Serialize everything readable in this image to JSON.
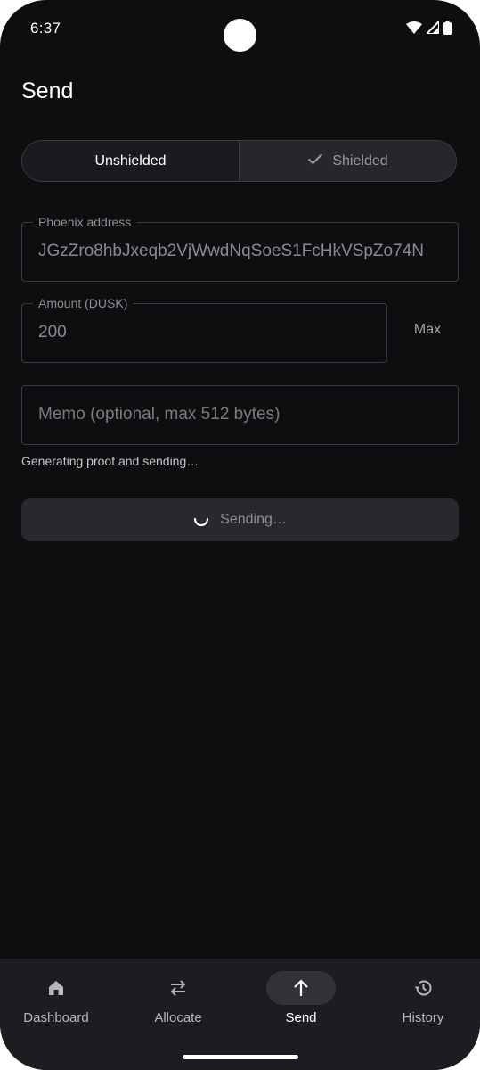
{
  "status_bar": {
    "time": "6:37"
  },
  "page": {
    "title": "Send"
  },
  "toggle": {
    "unshielded_label": "Unshielded",
    "shielded_label": "Shielded",
    "selected": "Unshielded"
  },
  "address_field": {
    "label": "Phoenix address",
    "value": "JGzZro8hbJxeqb2VjWwdNqSoeS1FcHkVSpZo74N"
  },
  "amount_field": {
    "label": "Amount (DUSK)",
    "value": "200",
    "max_label": "Max"
  },
  "memo_field": {
    "placeholder": "Memo (optional, max 512 bytes)"
  },
  "status": {
    "message": "Generating proof and sending…"
  },
  "send_button": {
    "label": "Sending…"
  },
  "bottom_nav": {
    "items": [
      {
        "label": "Dashboard",
        "icon": "home-icon"
      },
      {
        "label": "Allocate",
        "icon": "swap-arrows-icon"
      },
      {
        "label": "Send",
        "icon": "arrow-up-icon"
      },
      {
        "label": "History",
        "icon": "history-icon"
      }
    ],
    "active": "Send"
  },
  "colors": {
    "background": "#0e0e10",
    "surface": "#1d1d21",
    "outline": "#3a3a40"
  }
}
